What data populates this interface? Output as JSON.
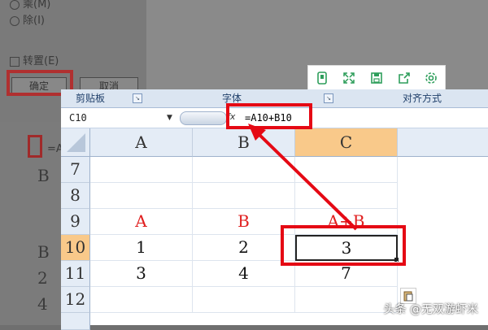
{
  "background_dialog": {
    "options": [
      "乘(M)",
      "除(I)"
    ],
    "transpose_label": "转置(E)",
    "ok_button": "确定",
    "cancel_button": "取消",
    "left_strip_cells": [
      {
        "text": "=A"
      },
      {
        "text": "B"
      },
      {
        "text": "B"
      },
      {
        "text": "2"
      },
      {
        "text": "4"
      }
    ]
  },
  "mini_toolbar": {
    "icons": [
      "phone-icon",
      "expand-icon",
      "save-icon",
      "share-icon",
      "settings-icon"
    ]
  },
  "ribbon": {
    "groups": [
      "剪贴板",
      "字体",
      "对齐方式"
    ]
  },
  "formula_bar": {
    "name_box": "C10",
    "fx_label": "fx",
    "formula": "=A10+B10"
  },
  "sheet": {
    "columns": [
      "A",
      "B",
      "C"
    ],
    "selected_column": "C",
    "rows": [
      {
        "num": "7",
        "a": "",
        "b": "",
        "c": ""
      },
      {
        "num": "8",
        "a": "",
        "b": "",
        "c": ""
      },
      {
        "num": "9",
        "a": "A",
        "b": "B",
        "c": "A+B"
      },
      {
        "num": "10",
        "a": "1",
        "b": "2",
        "c": "3"
      },
      {
        "num": "11",
        "a": "3",
        "b": "4",
        "c": "7"
      },
      {
        "num": "12",
        "a": "",
        "b": "",
        "c": ""
      }
    ],
    "selected_row": "10",
    "header_color": "#e02020"
  },
  "colors": {
    "annotation": "#e50914",
    "selected_header": "#f9c98a"
  },
  "watermark": "头条 @无双游虾米"
}
